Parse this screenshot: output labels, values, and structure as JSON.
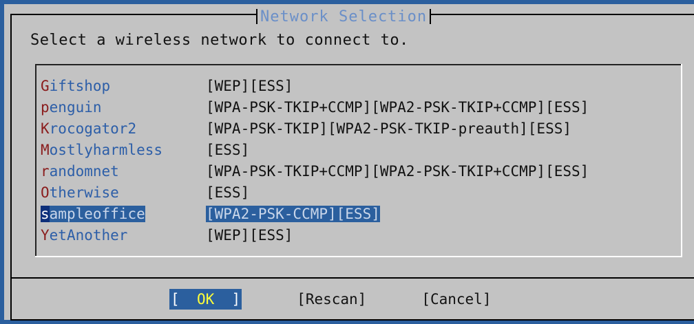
{
  "dialog": {
    "title": "Network Selection",
    "prompt": "Select a wireless network to connect to."
  },
  "networks": [
    {
      "hotkey": "G",
      "rest": "iftshop",
      "flags": "[WEP][ESS]",
      "selected": false
    },
    {
      "hotkey": "p",
      "rest": "enguin",
      "flags": "[WPA-PSK-TKIP+CCMP][WPA2-PSK-TKIP+CCMP][ESS]",
      "selected": false
    },
    {
      "hotkey": "K",
      "rest": "rocogator2",
      "flags": "[WPA-PSK-TKIP][WPA2-PSK-TKIP-preauth][ESS]",
      "selected": false
    },
    {
      "hotkey": "M",
      "rest": "ostlyharmless",
      "flags": "[ESS]",
      "selected": false
    },
    {
      "hotkey": "r",
      "rest": "andomnet",
      "flags": "[WPA-PSK-TKIP+CCMP][WPA2-PSK-TKIP+CCMP][ESS]",
      "selected": false
    },
    {
      "hotkey": "O",
      "rest": "therwise",
      "flags": "[ESS]",
      "selected": false
    },
    {
      "hotkey": "s",
      "rest": "ampleoffice",
      "flags": "[WPA2-PSK-CCMP][ESS]",
      "selected": true
    },
    {
      "hotkey": "Y",
      "rest": "etAnother",
      "flags": "[WEP][ESS]",
      "selected": false
    }
  ],
  "buttons": {
    "ok_open": "[  ",
    "ok_label": "OK",
    "ok_close": "  ]",
    "rescan": "[Rescan]",
    "cancel": "[Cancel]"
  },
  "colors": {
    "screen_background": "#2b5f9e",
    "dialog_background": "#c3c3c3",
    "title_text": "#6a8fc8",
    "hotkey": "#8a1c1c",
    "selection": "#2b5f9e",
    "ok_label": "#ffff3a"
  }
}
